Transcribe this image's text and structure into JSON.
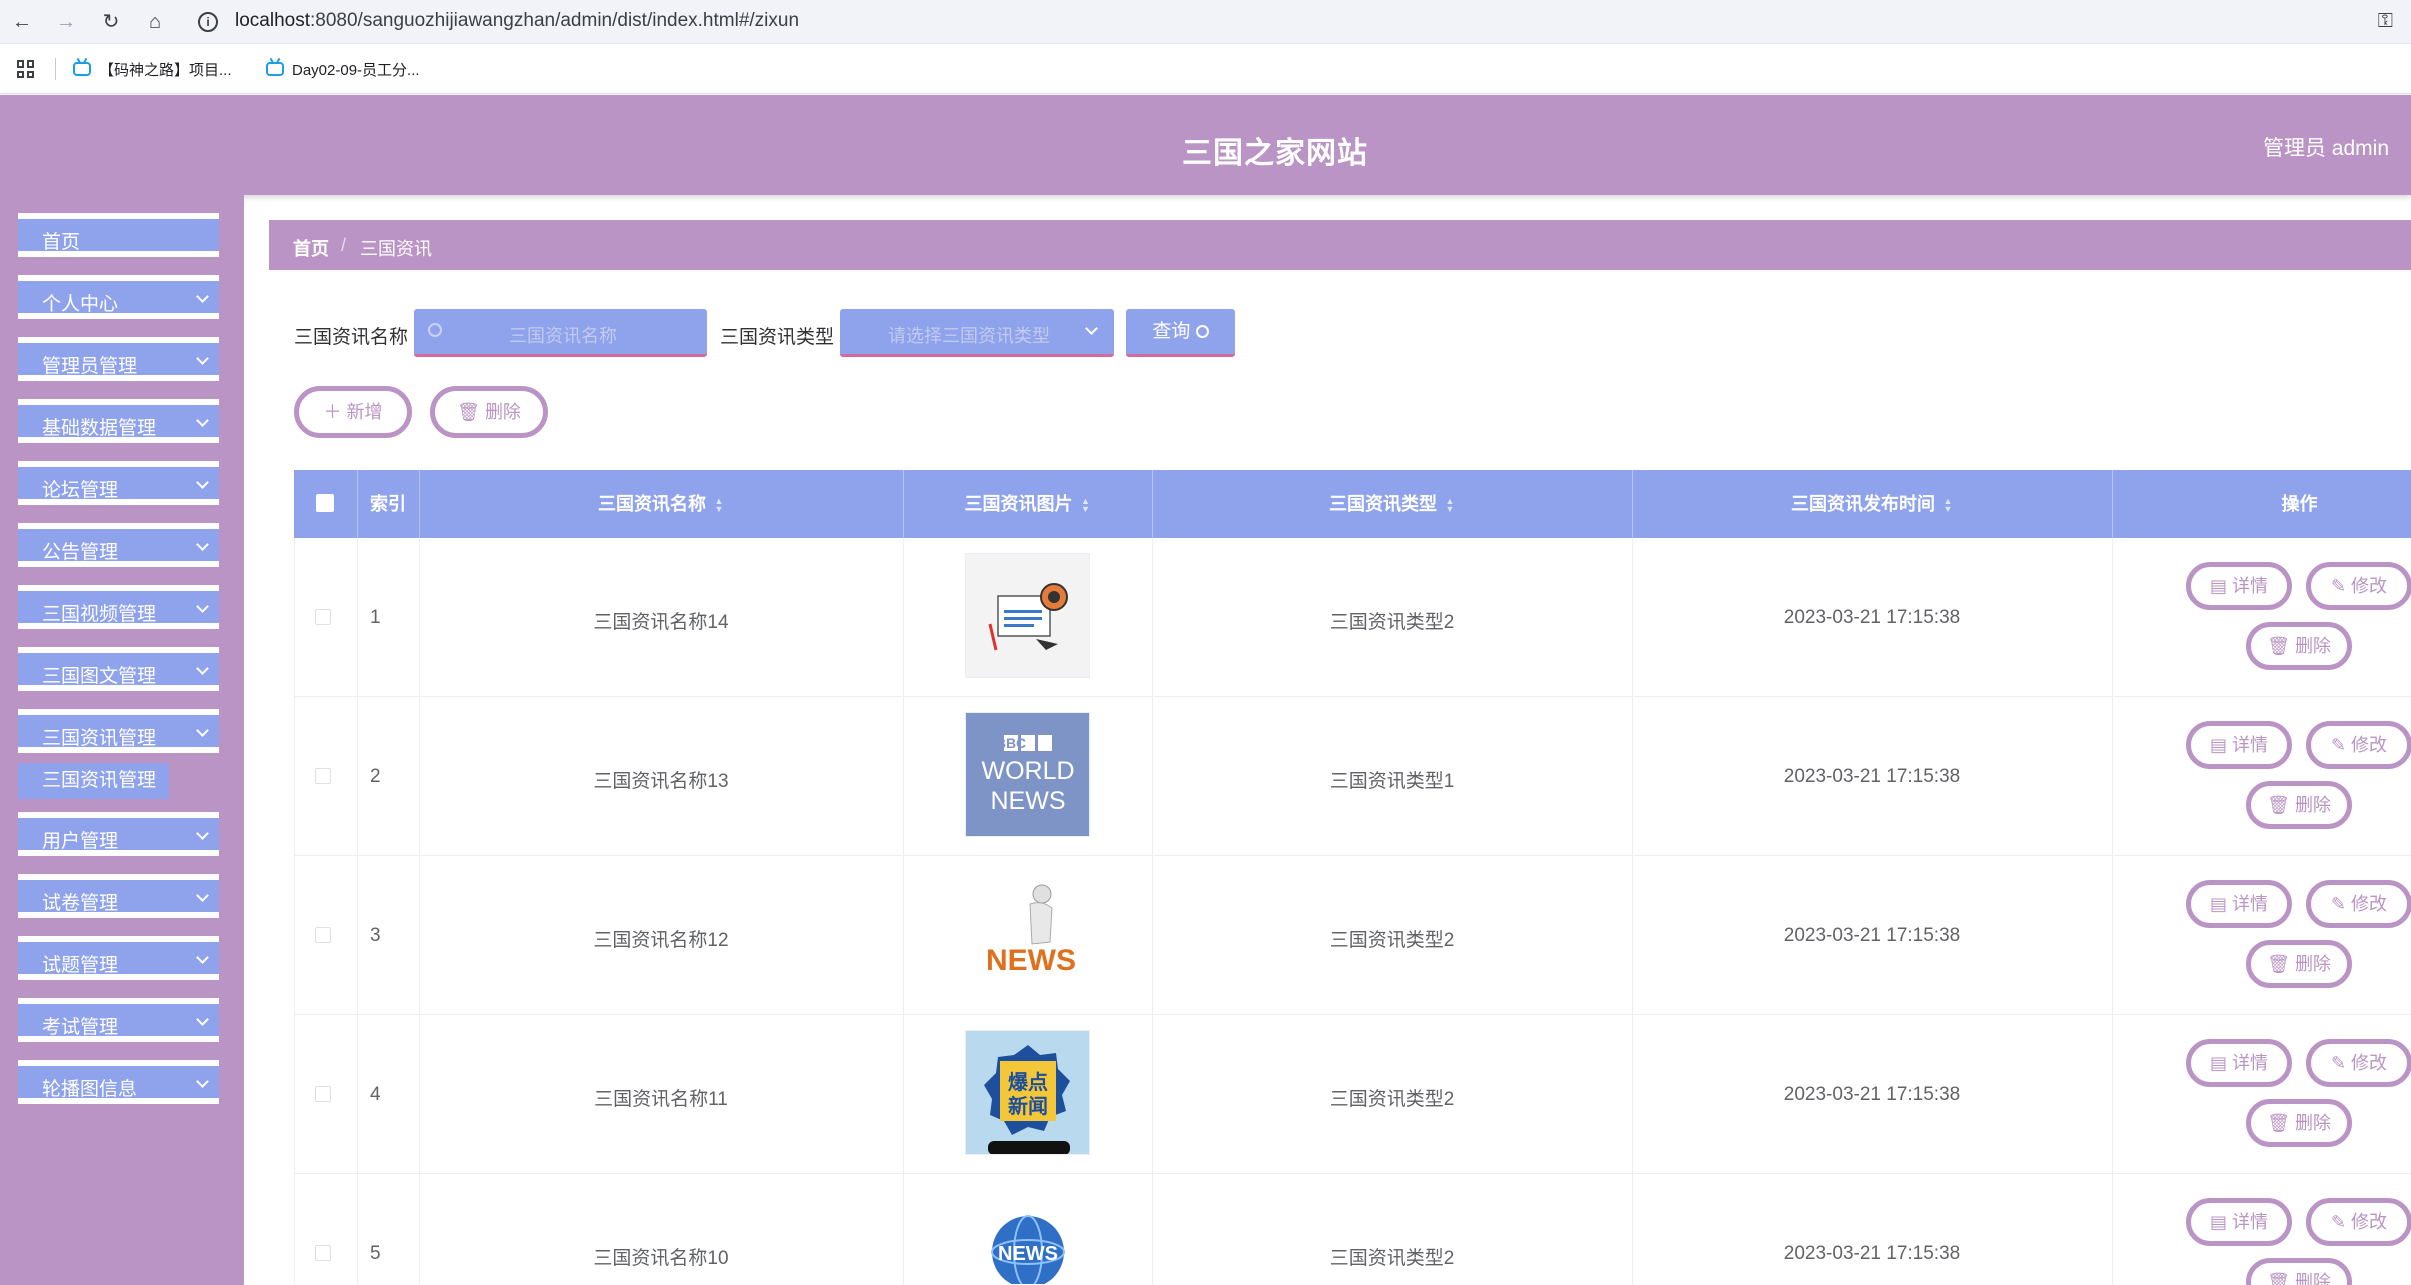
{
  "browser": {
    "url_host": "localhost",
    "url_rest": ":8080/sanguozhijiawangzhan/admin/dist/index.html#/zixun",
    "bookmarks": [
      "【码神之路】项目...",
      "Day02-09-员工分..."
    ]
  },
  "header": {
    "title": "三国之家网站",
    "user": "管理员 admin"
  },
  "sidebar": {
    "items": [
      {
        "label": "首页"
      },
      {
        "label": "个人中心"
      },
      {
        "label": "管理员管理"
      },
      {
        "label": "基础数据管理"
      },
      {
        "label": "论坛管理"
      },
      {
        "label": "公告管理"
      },
      {
        "label": "三国视频管理"
      },
      {
        "label": "三国图文管理"
      },
      {
        "label": "三国资讯管理"
      },
      {
        "label": "用户管理"
      },
      {
        "label": "试卷管理"
      },
      {
        "label": "试题管理"
      },
      {
        "label": "考试管理"
      },
      {
        "label": "轮播图信息"
      }
    ],
    "active_sub": "三国资讯管理"
  },
  "breadcrumb": {
    "home": "首页",
    "sep": "/",
    "current": "三国资讯"
  },
  "filters": {
    "name_label": "三国资讯名称",
    "name_placeholder": "三国资讯名称",
    "type_label": "三国资讯类型",
    "type_placeholder": "请选择三国资讯类型",
    "query_label": "查询"
  },
  "actions": {
    "add_label": "新增",
    "delete_label": "删除"
  },
  "table": {
    "headers": [
      "索引",
      "三国资讯名称",
      "三国资讯图片",
      "三国资讯类型",
      "三国资讯发布时间",
      "操作"
    ],
    "row_actions": {
      "detail": "详情",
      "edit": "修改",
      "delete": "删除"
    },
    "rows": [
      {
        "index": "1",
        "name": "三国资讯名称14",
        "type": "三国资讯类型2",
        "time": "2023-03-21 17:15:38",
        "image": "news-paper-icon"
      },
      {
        "index": "2",
        "name": "三国资讯名称13",
        "type": "三国资讯类型1",
        "time": "2023-03-21 17:15:38",
        "image": "bbc-world-news-logo",
        "image_text": [
          "BBC",
          "WORLD",
          "NEWS"
        ]
      },
      {
        "index": "3",
        "name": "三国资讯名称12",
        "type": "三国资讯类型2",
        "time": "2023-03-21 17:15:38",
        "image": "news-figure-icon",
        "image_text": [
          "NEWS"
        ]
      },
      {
        "index": "4",
        "name": "三国资讯名称11",
        "type": "三国资讯类型2",
        "time": "2023-03-21 17:15:38",
        "image": "breaking-news-badge",
        "image_text": [
          "爆点",
          "新闻"
        ]
      },
      {
        "index": "5",
        "name": "三国资讯名称10",
        "type": "三国资讯类型2",
        "time": "2023-03-21 17:15:38",
        "image": "news-globe-icon",
        "image_text": [
          "NEWS"
        ]
      }
    ]
  },
  "colors": {
    "header": "#ba94c4",
    "menu": "#8fa2ec",
    "accent": "#d46a9e"
  }
}
